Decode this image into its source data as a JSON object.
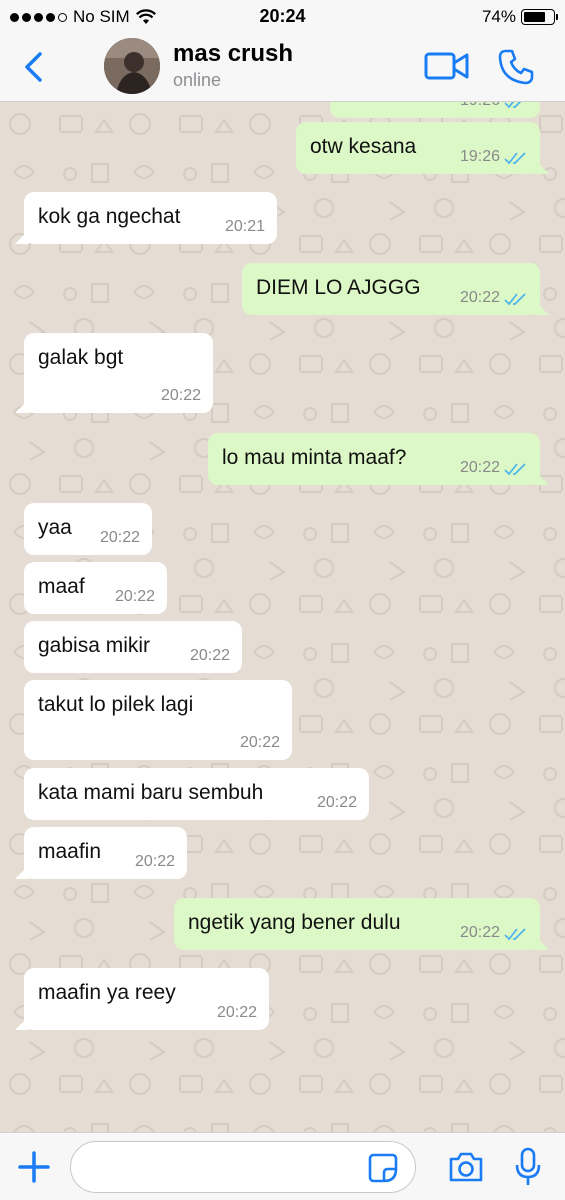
{
  "status_bar": {
    "carrier": "No SIM",
    "time": "20:24",
    "battery": "74%",
    "battery_level": 0.74,
    "signal_bars_filled": 4
  },
  "header": {
    "back_icon": "chevron-left-icon",
    "contact_name": "mas crush",
    "contact_status": "online",
    "video_icon": "video-camera-icon",
    "call_icon": "phone-icon"
  },
  "colors": {
    "accent": "#1a7cf4",
    "outgoing_bubble": "#dcf8c6",
    "incoming_bubble": "#ffffff",
    "chat_background": "#e5ddd3",
    "read_ticks": "#4fb6ec"
  },
  "messages": [
    {
      "direction": "out",
      "text": "",
      "time": "19:26",
      "read": true
    },
    {
      "direction": "out",
      "text": "otw kesana",
      "time": "19:26",
      "read": true
    },
    {
      "direction": "in",
      "text": "kok ga ngechat",
      "time": "20:21"
    },
    {
      "direction": "out",
      "text": "DIEM LO AJGGG",
      "time": "20:22",
      "read": true
    },
    {
      "direction": "in",
      "text": "galak bgt",
      "time": "20:22"
    },
    {
      "direction": "out",
      "text": "lo mau minta maaf?",
      "time": "20:22",
      "read": true
    },
    {
      "direction": "in",
      "text": "yaa",
      "time": "20:22"
    },
    {
      "direction": "in",
      "text": "maaf",
      "time": "20:22"
    },
    {
      "direction": "in",
      "text": "gabisa mikir",
      "time": "20:22"
    },
    {
      "direction": "in",
      "text": "takut lo pilek lagi",
      "time": "20:22"
    },
    {
      "direction": "in",
      "text": "kata mami baru sembuh",
      "time": "20:22"
    },
    {
      "direction": "in",
      "text": "maafin",
      "time": "20:22"
    },
    {
      "direction": "out",
      "text": "ngetik yang bener dulu",
      "time": "20:22",
      "read": true
    },
    {
      "direction": "in",
      "text": "maafin ya reey",
      "time": "20:22"
    }
  ],
  "input_bar": {
    "plus_icon": "plus-icon",
    "message_value": "",
    "sticker_icon": "sticker-icon",
    "camera_icon": "camera-icon",
    "mic_icon": "microphone-icon"
  }
}
